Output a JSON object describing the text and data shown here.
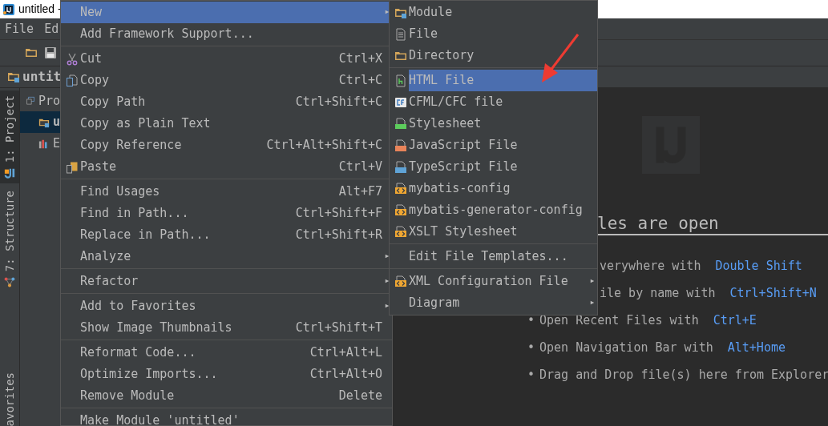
{
  "window": {
    "title": "untitled -"
  },
  "menu_bar": [
    {
      "label": "File"
    },
    {
      "label": "Ed"
    }
  ],
  "navigation_bar": {
    "label": "untit"
  },
  "tool_windows": [
    {
      "label": "1: Project",
      "selected": true
    },
    {
      "label": "7: Structure",
      "selected": false
    },
    {
      "label": "avorites",
      "selected": false
    }
  ],
  "project_panel": {
    "view": "Pro",
    "tree": [
      {
        "label": "u",
        "selected": true
      },
      {
        "label": "E",
        "selected": false
      }
    ]
  },
  "context_menu": [
    {
      "kind": "item",
      "label": "New",
      "selected": true,
      "has_submenu": true
    },
    {
      "kind": "item",
      "label": "Add Framework Support...",
      "selected": false,
      "has_submenu": false
    },
    {
      "kind": "separator"
    },
    {
      "kind": "item",
      "label": "Cut",
      "shortcut": "Ctrl+X",
      "selected": false,
      "has_submenu": false
    },
    {
      "kind": "item",
      "label": "Copy",
      "shortcut": "Ctrl+C",
      "selected": false,
      "has_submenu": false
    },
    {
      "kind": "item",
      "label": "Copy Path",
      "shortcut": "Ctrl+Shift+C",
      "selected": false,
      "has_submenu": false
    },
    {
      "kind": "item",
      "label": "Copy as Plain Text",
      "selected": false,
      "has_submenu": false
    },
    {
      "kind": "item",
      "label": "Copy Reference",
      "shortcut": "Ctrl+Alt+Shift+C",
      "selected": false,
      "has_submenu": false
    },
    {
      "kind": "item",
      "label": "Paste",
      "shortcut": "Ctrl+V",
      "selected": false,
      "has_submenu": false
    },
    {
      "kind": "separator"
    },
    {
      "kind": "item",
      "label": "Find Usages",
      "shortcut": "Alt+F7",
      "selected": false,
      "has_submenu": false
    },
    {
      "kind": "item",
      "label": "Find in Path...",
      "shortcut": "Ctrl+Shift+F",
      "selected": false,
      "has_submenu": false
    },
    {
      "kind": "item",
      "label": "Replace in Path...",
      "shortcut": "Ctrl+Shift+R",
      "selected": false,
      "has_submenu": false
    },
    {
      "kind": "item",
      "label": "Analyze",
      "selected": false,
      "has_submenu": true
    },
    {
      "kind": "separator"
    },
    {
      "kind": "item",
      "label": "Refactor",
      "selected": false,
      "has_submenu": true
    },
    {
      "kind": "separator"
    },
    {
      "kind": "item",
      "label": "Add to Favorites",
      "selected": false,
      "has_submenu": true
    },
    {
      "kind": "item",
      "label": "Show Image Thumbnails",
      "shortcut": "Ctrl+Shift+T",
      "selected": false,
      "has_submenu": false
    },
    {
      "kind": "separator"
    },
    {
      "kind": "item",
      "label": "Reformat Code...",
      "shortcut": "Ctrl+Alt+L",
      "selected": false,
      "has_submenu": false
    },
    {
      "kind": "item",
      "label": "Optimize Imports...",
      "shortcut": "Ctrl+Alt+O",
      "selected": false,
      "has_submenu": false
    },
    {
      "kind": "item",
      "label": "Remove Module",
      "shortcut": "Delete",
      "selected": false,
      "has_submenu": false
    },
    {
      "kind": "separator"
    },
    {
      "kind": "item",
      "label": "Make Module 'untitled'",
      "selected": false,
      "has_submenu": false
    }
  ],
  "new_submenu": [
    {
      "kind": "item",
      "label": "Module",
      "selected": false,
      "has_submenu": false
    },
    {
      "kind": "item",
      "label": "File",
      "selected": false,
      "has_submenu": false
    },
    {
      "kind": "item",
      "label": "Directory",
      "selected": false,
      "has_submenu": false
    },
    {
      "kind": "separator"
    },
    {
      "kind": "item",
      "label": "HTML File",
      "selected": true,
      "has_submenu": false
    },
    {
      "kind": "item",
      "label": "CFML/CFC file",
      "selected": false,
      "has_submenu": false
    },
    {
      "kind": "item",
      "label": "Stylesheet",
      "selected": false,
      "has_submenu": false
    },
    {
      "kind": "item",
      "label": "JavaScript File",
      "selected": false,
      "has_submenu": false
    },
    {
      "kind": "item",
      "label": "TypeScript File",
      "selected": false,
      "has_submenu": false
    },
    {
      "kind": "item",
      "label": "mybatis-config",
      "selected": false,
      "has_submenu": false
    },
    {
      "kind": "item",
      "label": "mybatis-generator-config",
      "selected": false,
      "has_submenu": false
    },
    {
      "kind": "item",
      "label": "XSLT Stylesheet",
      "selected": false,
      "has_submenu": false
    },
    {
      "kind": "separator"
    },
    {
      "kind": "item",
      "label": "Edit File Templates...",
      "selected": false,
      "has_submenu": false
    },
    {
      "kind": "separator"
    },
    {
      "kind": "item",
      "label": "XML Configuration File",
      "selected": false,
      "has_submenu": true
    },
    {
      "kind": "item",
      "label": "Diagram",
      "selected": false,
      "has_submenu": true
    }
  ],
  "editor": {
    "heading": "les are open",
    "hints": [
      {
        "text": "verywhere with",
        "key": "Double Shift"
      },
      {
        "text": "ile by name with",
        "key": "Ctrl+Shift+N"
      },
      {
        "bullet": "•",
        "text": "Open Recent Files with",
        "key": "Ctrl+E"
      },
      {
        "bullet": "•",
        "text": "Open Navigation Bar with",
        "key": "Alt+Home"
      },
      {
        "bullet": "•",
        "text": "Drag and Drop file(s) here from Explorer"
      }
    ]
  }
}
